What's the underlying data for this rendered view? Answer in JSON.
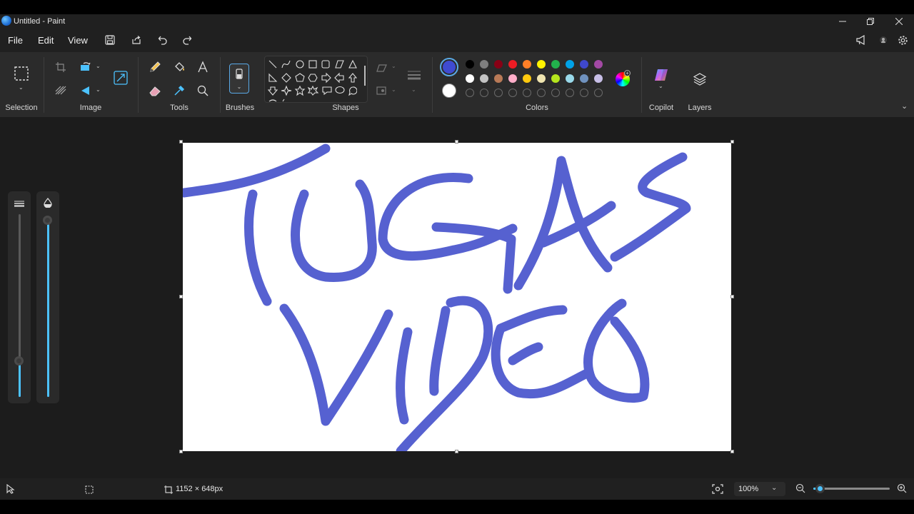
{
  "window": {
    "title": "Untitled - Paint"
  },
  "menu": {
    "file": "File",
    "edit": "Edit",
    "view": "View"
  },
  "ribbon": {
    "selection": "Selection",
    "image": "Image",
    "tools": "Tools",
    "brushes": "Brushes",
    "shapes": "Shapes",
    "colors": "Colors",
    "copilot": "Copilot",
    "layers": "Layers"
  },
  "colors": {
    "primary": "#3f4bd1",
    "secondary": "#ffffff",
    "palette_row1": [
      "#000000",
      "#7f7f7f",
      "#880015",
      "#ed1c24",
      "#ff7f27",
      "#fff200",
      "#22b14c",
      "#00a2e8",
      "#3f48cc",
      "#a349a4"
    ],
    "palette_row2": [
      "#ffffff",
      "#c3c3c3",
      "#b97a57",
      "#ffaec9",
      "#ffc90e",
      "#efe4b0",
      "#b5e61d",
      "#99d9ea",
      "#7092be",
      "#c8bfe7"
    ]
  },
  "canvas": {
    "text_line1": "TUGAS",
    "text_line2": "VIDEO",
    "stroke_color": "#4450cc"
  },
  "status": {
    "canvas_size": "1152 × 648px",
    "zoom": "100%",
    "zoom_slider_fraction": 0.08
  },
  "sliders": {
    "size_fraction": 0.2,
    "opacity_fraction": 1.0
  }
}
